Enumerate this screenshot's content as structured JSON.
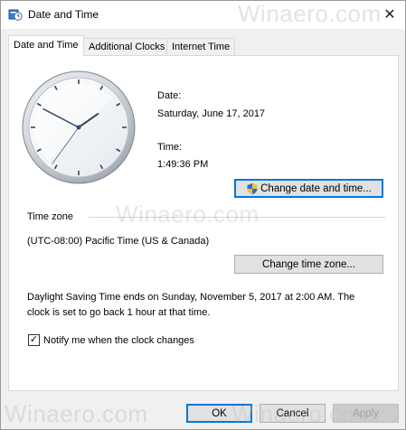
{
  "window": {
    "title": "Date and Time",
    "close_glyph": "✕",
    "watermark_text": "Winaero.com"
  },
  "tabs": [
    {
      "label": "Date and Time",
      "active": true
    },
    {
      "label": "Additional Clocks",
      "active": false
    },
    {
      "label": "Internet Time",
      "active": false
    }
  ],
  "clock": {
    "hour": 1,
    "minute": 49,
    "second": 36
  },
  "date": {
    "label": "Date:",
    "value": "Saturday, June 17, 2017"
  },
  "time": {
    "label": "Time:",
    "value": "1:49:36 PM"
  },
  "buttons": {
    "change_date_time": "Change date and time...",
    "change_time_zone": "Change time zone...",
    "ok": "OK",
    "cancel": "Cancel",
    "apply": "Apply"
  },
  "timezone": {
    "section_label": "Time zone",
    "value": "(UTC-08:00) Pacific Time (US & Canada)"
  },
  "dst": {
    "line1": "Daylight Saving Time ends on Sunday, November 5, 2017 at 2:00 AM. The",
    "line2": "clock is set to go back 1 hour at that time."
  },
  "notify": {
    "label": "Notify me when the clock changes",
    "checked": true,
    "check_glyph": "✓"
  },
  "icons": {
    "title": "clock-window-icon",
    "shield": "uac-shield-icon",
    "close": "close-icon"
  },
  "colors": {
    "accent": "#0078d7",
    "panel_bg": "#ffffff",
    "window_bg": "#f0f0f0"
  }
}
